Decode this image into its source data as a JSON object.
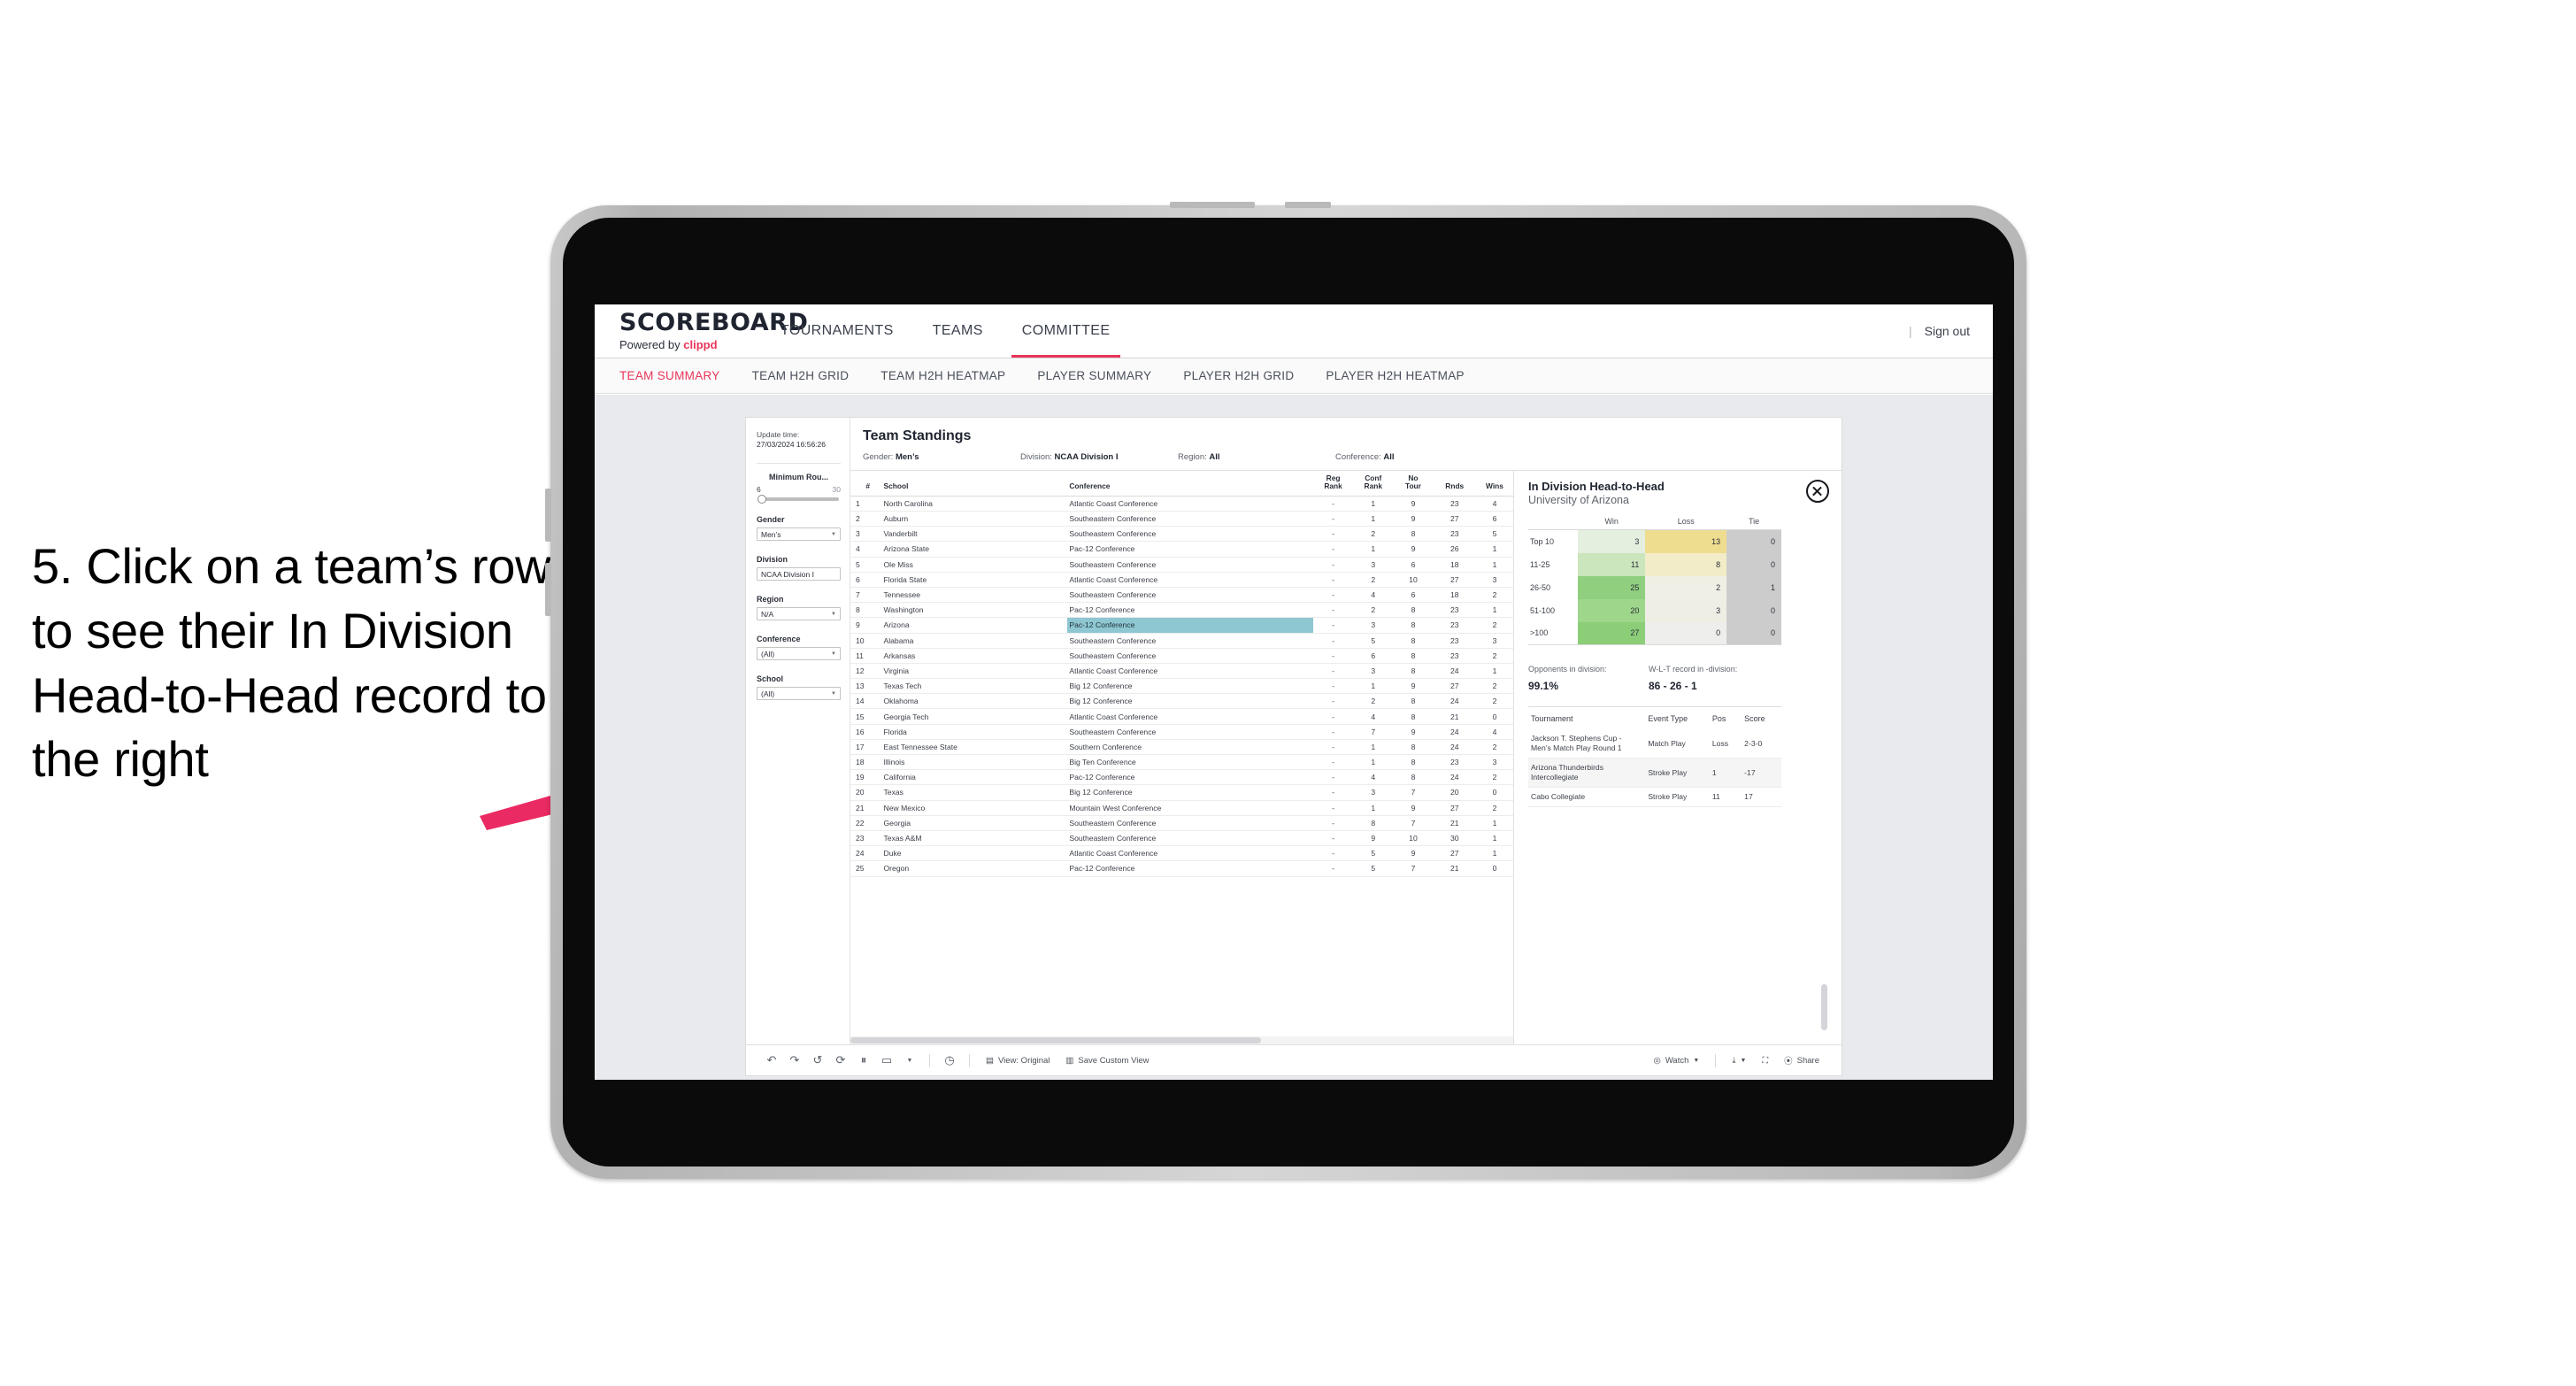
{
  "instruction": "5. Click on a team’s row to see their In Division Head-to-Head record to the right",
  "colors": {
    "accent": "#e8355a",
    "arrow": "#ea2a62",
    "highlight_row": "#8ec7d2",
    "bezel": "#c9c9c9"
  },
  "topnav": {
    "brand_title": "SCOREBOARD",
    "brand_sub_prefix": "Powered by ",
    "brand_sub_name": "clippd",
    "items": [
      {
        "label": "TOURNAMENTS",
        "active": false
      },
      {
        "label": "TEAMS",
        "active": false
      },
      {
        "label": "COMMITTEE",
        "active": true
      }
    ],
    "pipe": "|",
    "sign_out": "Sign out"
  },
  "subnav": {
    "items": [
      {
        "label": "TEAM SUMMARY",
        "active": true
      },
      {
        "label": "TEAM H2H GRID",
        "active": false
      },
      {
        "label": "TEAM H2H HEATMAP",
        "active": false
      },
      {
        "label": "PLAYER SUMMARY",
        "active": false
      },
      {
        "label": "PLAYER H2H GRID",
        "active": false
      },
      {
        "label": "PLAYER H2H HEATMAP",
        "active": false
      }
    ]
  },
  "filters": {
    "update_label": "Update time:",
    "update_time": "27/03/2024 16:56:26",
    "slider": {
      "title": "Minimum Rou...",
      "min": "6",
      "max": "30"
    },
    "selects": [
      {
        "title": "Gender",
        "value": "Men’s"
      },
      {
        "title": "Division",
        "value": "NCAA Division I"
      },
      {
        "title": "Region",
        "value": "N/A"
      },
      {
        "title": "Conference",
        "value": "(All)"
      },
      {
        "title": "School",
        "value": "(All)"
      }
    ]
  },
  "standings": {
    "title": "Team Standings",
    "meta": [
      {
        "label": "Gender: ",
        "value": "Men’s"
      },
      {
        "label": "Division: ",
        "value": "NCAA Division I"
      },
      {
        "label": "Region: ",
        "value": "All"
      },
      {
        "label": "Conference: ",
        "value": "All"
      }
    ],
    "columns": [
      "#",
      "School",
      "Conference",
      "Reg Rank",
      "Conf Rank",
      "No Tour",
      "Rnds",
      "Wins"
    ],
    "rows": [
      {
        "n": "1",
        "school": "North Carolina",
        "conf": "Atlantic Coast Conference",
        "reg": "-",
        "cr": "1",
        "nt": "9",
        "rn": "23",
        "wn": "4"
      },
      {
        "n": "2",
        "school": "Auburn",
        "conf": "Southeastern Conference",
        "reg": "-",
        "cr": "1",
        "nt": "9",
        "rn": "27",
        "wn": "6"
      },
      {
        "n": "3",
        "school": "Vanderbilt",
        "conf": "Southeastern Conference",
        "reg": "-",
        "cr": "2",
        "nt": "8",
        "rn": "23",
        "wn": "5"
      },
      {
        "n": "4",
        "school": "Arizona State",
        "conf": "Pac-12 Conference",
        "reg": "-",
        "cr": "1",
        "nt": "9",
        "rn": "26",
        "wn": "1"
      },
      {
        "n": "5",
        "school": "Ole Miss",
        "conf": "Southeastern Conference",
        "reg": "-",
        "cr": "3",
        "nt": "6",
        "rn": "18",
        "wn": "1"
      },
      {
        "n": "6",
        "school": "Florida State",
        "conf": "Atlantic Coast Conference",
        "reg": "-",
        "cr": "2",
        "nt": "10",
        "rn": "27",
        "wn": "3"
      },
      {
        "n": "7",
        "school": "Tennessee",
        "conf": "Southeastern Conference",
        "reg": "-",
        "cr": "4",
        "nt": "6",
        "rn": "18",
        "wn": "2"
      },
      {
        "n": "8",
        "school": "Washington",
        "conf": "Pac-12 Conference",
        "reg": "-",
        "cr": "2",
        "nt": "8",
        "rn": "23",
        "wn": "1"
      },
      {
        "n": "9",
        "school": "Arizona",
        "conf": "Pac-12 Conference",
        "reg": "-",
        "cr": "3",
        "nt": "8",
        "rn": "23",
        "wn": "2",
        "highlight": true
      },
      {
        "n": "10",
        "school": "Alabama",
        "conf": "Southeastern Conference",
        "reg": "-",
        "cr": "5",
        "nt": "8",
        "rn": "23",
        "wn": "3"
      },
      {
        "n": "11",
        "school": "Arkansas",
        "conf": "Southeastern Conference",
        "reg": "-",
        "cr": "6",
        "nt": "8",
        "rn": "23",
        "wn": "2"
      },
      {
        "n": "12",
        "school": "Virginia",
        "conf": "Atlantic Coast Conference",
        "reg": "-",
        "cr": "3",
        "nt": "8",
        "rn": "24",
        "wn": "1"
      },
      {
        "n": "13",
        "school": "Texas Tech",
        "conf": "Big 12 Conference",
        "reg": "-",
        "cr": "1",
        "nt": "9",
        "rn": "27",
        "wn": "2"
      },
      {
        "n": "14",
        "school": "Oklahoma",
        "conf": "Big 12 Conference",
        "reg": "-",
        "cr": "2",
        "nt": "8",
        "rn": "24",
        "wn": "2"
      },
      {
        "n": "15",
        "school": "Georgia Tech",
        "conf": "Atlantic Coast Conference",
        "reg": "-",
        "cr": "4",
        "nt": "8",
        "rn": "21",
        "wn": "0"
      },
      {
        "n": "16",
        "school": "Florida",
        "conf": "Southeastern Conference",
        "reg": "-",
        "cr": "7",
        "nt": "9",
        "rn": "24",
        "wn": "4"
      },
      {
        "n": "17",
        "school": "East Tennessee State",
        "conf": "Southern Conference",
        "reg": "-",
        "cr": "1",
        "nt": "8",
        "rn": "24",
        "wn": "2"
      },
      {
        "n": "18",
        "school": "Illinois",
        "conf": "Big Ten Conference",
        "reg": "-",
        "cr": "1",
        "nt": "8",
        "rn": "23",
        "wn": "3"
      },
      {
        "n": "19",
        "school": "California",
        "conf": "Pac-12 Conference",
        "reg": "-",
        "cr": "4",
        "nt": "8",
        "rn": "24",
        "wn": "2"
      },
      {
        "n": "20",
        "school": "Texas",
        "conf": "Big 12 Conference",
        "reg": "-",
        "cr": "3",
        "nt": "7",
        "rn": "20",
        "wn": "0"
      },
      {
        "n": "21",
        "school": "New Mexico",
        "conf": "Mountain West Conference",
        "reg": "-",
        "cr": "1",
        "nt": "9",
        "rn": "27",
        "wn": "2"
      },
      {
        "n": "22",
        "school": "Georgia",
        "conf": "Southeastern Conference",
        "reg": "-",
        "cr": "8",
        "nt": "7",
        "rn": "21",
        "wn": "1"
      },
      {
        "n": "23",
        "school": "Texas A&M",
        "conf": "Southeastern Conference",
        "reg": "-",
        "cr": "9",
        "nt": "10",
        "rn": "30",
        "wn": "1"
      },
      {
        "n": "24",
        "school": "Duke",
        "conf": "Atlantic Coast Conference",
        "reg": "-",
        "cr": "5",
        "nt": "9",
        "rn": "27",
        "wn": "1"
      },
      {
        "n": "25",
        "school": "Oregon",
        "conf": "Pac-12 Conference",
        "reg": "-",
        "cr": "5",
        "nt": "7",
        "rn": "21",
        "wn": "0"
      }
    ]
  },
  "h2h": {
    "title": "In Division Head-to-Head",
    "subtitle": "University of Arizona",
    "close_icon": "close-icon",
    "chart_data": {
      "type": "heatmap",
      "title": "In Division Head-to-Head",
      "subtitle": "University of Arizona",
      "columns": [
        "Win",
        "Loss",
        "Tie"
      ],
      "rows": [
        "Top 10",
        "11-25",
        "26-50",
        "51-100",
        ">100"
      ],
      "values": [
        [
          3,
          13,
          0
        ],
        [
          11,
          8,
          0
        ],
        [
          25,
          2,
          1
        ],
        [
          20,
          3,
          0
        ],
        [
          27,
          0,
          0
        ]
      ],
      "cell_colors": [
        [
          "#e4efe0",
          "#efdd8f",
          "#cccccc"
        ],
        [
          "#cbe5bd",
          "#f3ecc9",
          "#cccccc"
        ],
        [
          "#8fcf7e",
          "#f0efe6",
          "#cccccc"
        ],
        [
          "#9ed68c",
          "#efeee4",
          "#cccccc"
        ],
        [
          "#8ccd78",
          "#eeeeec",
          "#cccccc"
        ]
      ]
    },
    "kpis": [
      {
        "label": "Opponents in division:",
        "value": "99.1%"
      },
      {
        "label": "W-L-T record in -division:",
        "value": "86 - 26 - 1"
      }
    ],
    "tournaments": {
      "columns": [
        "Tournament",
        "Event Type",
        "Pos",
        "Score"
      ],
      "rows": [
        {
          "name": "Jackson T. Stephens Cup - Men’s Match Play Round 1",
          "type": "Match Play",
          "pos": "Loss",
          "score": "2-3-0"
        },
        {
          "name": "Arizona Thunderbirds Intercollegiate",
          "type": "Stroke Play",
          "pos": "1",
          "score": "-17"
        },
        {
          "name": "Cabo Collegiate",
          "type": "Stroke Play",
          "pos": "11",
          "score": "17"
        }
      ]
    }
  },
  "toolbar": {
    "icons": [
      "undo-icon",
      "redo-icon",
      "revert-icon",
      "refresh-icon",
      "pause-icon",
      "layout-icon",
      "chevron-down-icon",
      "alert-icon"
    ],
    "view_label": "View: Original",
    "save_label": "Save Custom View",
    "watch_label": "Watch",
    "share_label": "Share"
  }
}
